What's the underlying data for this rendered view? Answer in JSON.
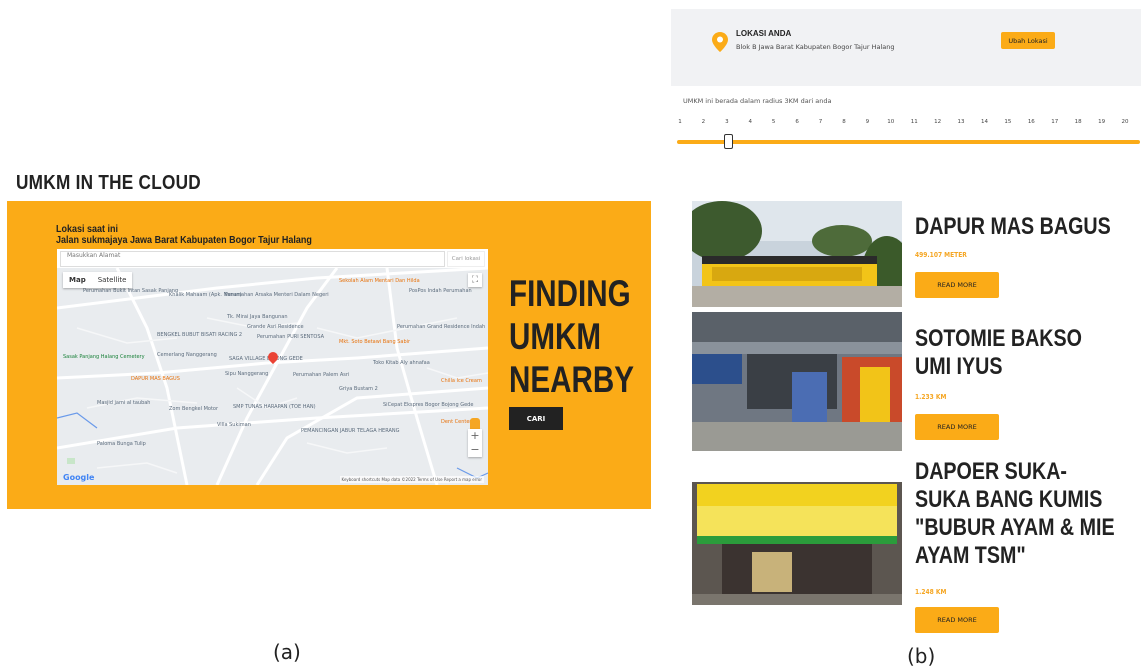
{
  "panel_a": {
    "title": "UMKM IN THE CLOUD",
    "location_label": "Lokasi saat ini",
    "location_value": "Jalan sukmajaya Jawa Barat Kabupaten Bogor Tajur Halang",
    "address_placeholder": "Masukkan Alamat",
    "cari_lokasi_label": "Cari lokasi",
    "map_types": [
      "Map",
      "Satellite"
    ],
    "map_brand": "Google",
    "map_footer": "Keyboard shortcuts   Map data ©2022   Terms of Use   Report a map error",
    "map_labels": {
      "p1": "Perumahan Bukit Intan Sasak Panjang",
      "p2": "Khalik Mahaam (Apk. Nanan)",
      "p3": "Perumahan Arsaka Menteri Dalam Negeri",
      "p4": "Sekolah Alam Mentari Dan Hilda",
      "p5": "PosPos Indah Perumahan",
      "p6": "Tk. Mirai Jaya Bangunan",
      "p7": "Grande Asri Residence",
      "p8": "Perumahan PURI SENTOSA",
      "p9": "BENGKEL BUBUT BISATI RACING 2",
      "p10": "Mkt. Soto Betawi Bang Sabir",
      "p11": "Perumahan Grand Residence Indah",
      "p12": "Sasak Panjang Halang Cemetery",
      "p13": "Cemerlang Nanggerang",
      "p14": "SAGA VILLAGE BUJONG GEDE",
      "p15": "Toko Kitab Aly ahnafaa",
      "p16": "Sipu Nanggerang",
      "p17": "DAPUR MAS BAGUS",
      "p18": "Perumahan Palem Asri",
      "p19": "Griya Bustam 2",
      "p20": "Chilla Ice Cream",
      "p21": "Masjid jami al taubah",
      "p22": "SMP TUNAS HARAPAN (TOE HAN)",
      "p23": "SiCepat Ekspres Bogor Bojong Gede",
      "p24": "Zom Bengkel Motor",
      "p25": "Villa Sukiman",
      "p26": "PEMANCINGAN JABUR TELAGA HERANG",
      "p27": "Dent Center",
      "p28": "Paloma Bunga Tulip"
    },
    "headline": "FINDING\nUMKM\nNEARBY",
    "search_button": "CARI",
    "figure_label": "(a)"
  },
  "panel_b": {
    "location_title": "LOKASI ANDA",
    "location_value": "Blok B Jawa Barat Kabupaten Bogor Tajur Halang",
    "change_location_button": "Ubah Lokasi",
    "radius_text": "UMKM ini berada dalam radius 3KM dari anda",
    "radius_scale": [
      "1",
      "2",
      "3",
      "4",
      "5",
      "6",
      "7",
      "8",
      "9",
      "10",
      "11",
      "12",
      "13",
      "14",
      "15",
      "16",
      "17",
      "18",
      "19",
      "20"
    ],
    "radius_value": 3,
    "cards": [
      {
        "name": "DAPUR MAS BAGUS",
        "distance": "499.107 METER",
        "button": "READ MORE"
      },
      {
        "name": "SOTOMIE BAKSO\nUMI IYUS",
        "distance": "1.233 KM",
        "button": "READ MORE"
      },
      {
        "name": "DAPOER SUKA-\nSUKA BANG KUMIS\n\"BUBUR AYAM & MIE\nAYAM TSM\"",
        "distance": "1.248 KM",
        "button": "READ MORE"
      }
    ],
    "figure_label": "(b)"
  },
  "colors": {
    "accent": "#fbab17",
    "dark": "#222222",
    "distance": "#f5a623"
  }
}
